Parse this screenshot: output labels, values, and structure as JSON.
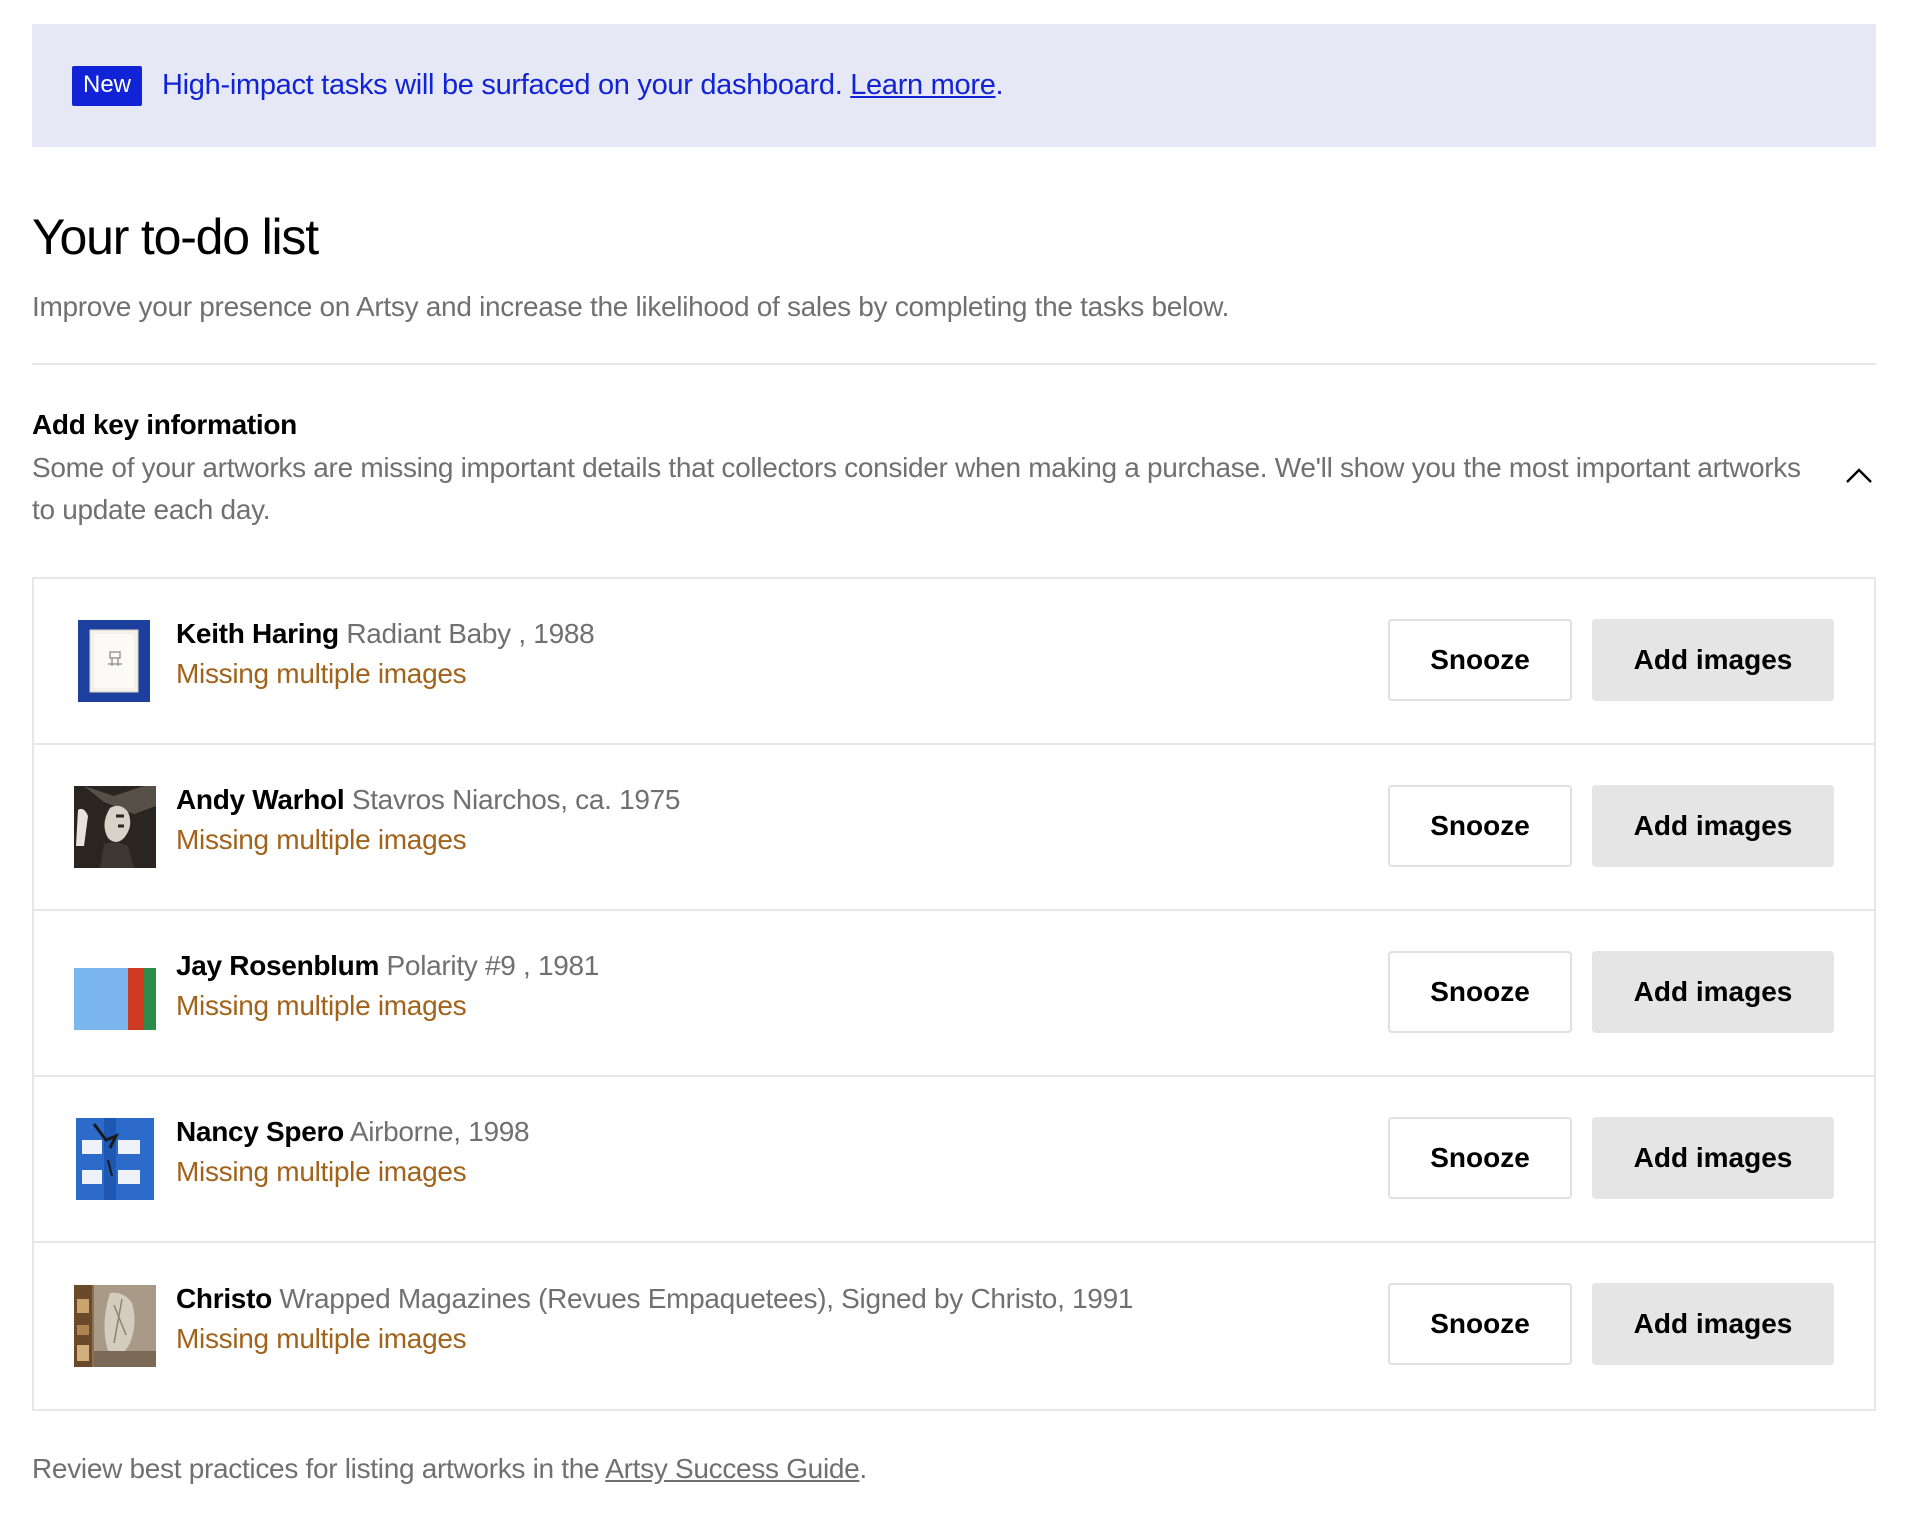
{
  "banner": {
    "badge": "New",
    "text": "High-impact tasks will be surfaced on your dashboard. ",
    "link": "Learn more",
    "suffix": "."
  },
  "page": {
    "title": "Your to-do list",
    "subtitle": "Improve your presence on Artsy and increase the likelihood of sales by completing the tasks below."
  },
  "section": {
    "title": "Add key information",
    "description": "Some of your artworks are missing important details that collectors consider when making a purchase. We'll show you the most important artworks to update each day.",
    "toggle_icon": "chevron-up-icon"
  },
  "tasks": [
    {
      "artist": "Keith Haring",
      "artwork": "Radiant Baby , 1988",
      "status": "Missing multiple images",
      "snooze": "Snooze",
      "action": "Add images"
    },
    {
      "artist": "Andy Warhol",
      "artwork": "Stavros Niarchos, ca. 1975",
      "status": "Missing multiple images",
      "snooze": "Snooze",
      "action": "Add images"
    },
    {
      "artist": "Jay Rosenblum",
      "artwork": "Polarity #9 , 1981",
      "status": "Missing multiple images",
      "snooze": "Snooze",
      "action": "Add images"
    },
    {
      "artist": "Nancy Spero",
      "artwork": "Airborne, 1998",
      "status": "Missing multiple images",
      "snooze": "Snooze",
      "action": "Add images"
    },
    {
      "artist": "Christo",
      "artwork": "Wrapped Magazines (Revues Empaquetees), Signed by Christo, 1991",
      "status": "Missing multiple images",
      "snooze": "Snooze",
      "action": "Add images"
    }
  ],
  "footer": {
    "text": "Review best practices for listing artworks in the ",
    "link": "Artsy Success Guide",
    "suffix": "."
  },
  "colors": {
    "accent": "#1023d7",
    "banner_bg": "#e6e8f6",
    "warning": "#a1621a",
    "muted_text": "#707070"
  }
}
